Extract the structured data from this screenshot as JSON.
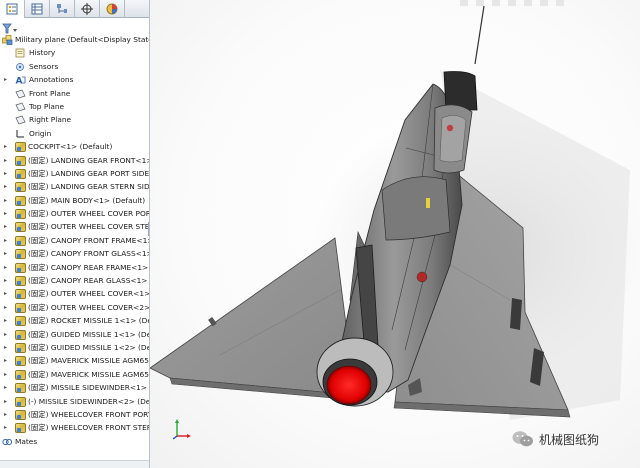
{
  "feature_tree": {
    "tabs": [
      {
        "icon": "feature-manager-icon"
      },
      {
        "icon": "property-manager-icon"
      },
      {
        "icon": "configuration-manager-icon"
      },
      {
        "icon": "dimxpert-manager-icon"
      },
      {
        "icon": "display-manager-icon"
      }
    ],
    "filter_icon": "filter-icon",
    "root": {
      "label": "Military plane  (Default<Display State-"
    },
    "folders": [
      {
        "label": "History",
        "icon": "history-icon",
        "expandable": false
      },
      {
        "label": "Sensors",
        "icon": "sensors-icon",
        "expandable": false
      },
      {
        "label": "Annotations",
        "icon": "annotations-icon",
        "expandable": true
      },
      {
        "label": "Front Plane",
        "icon": "plane-icon",
        "expandable": false
      },
      {
        "label": "Top Plane",
        "icon": "plane-icon",
        "expandable": false
      },
      {
        "label": "Right Plane",
        "icon": "plane-icon",
        "expandable": false
      },
      {
        "label": "Origin",
        "icon": "origin-icon",
        "expandable": false
      }
    ],
    "components": [
      "COCKPIT<1> (Default)",
      "(固定) LANDING GEAR FRONT<1>",
      "(固定) LANDING GEAR PORT SIDE",
      "(固定) LANDING GEAR STERN SIDE",
      "(固定) MAIN BODY<1> (Default)",
      "(固定) OUTER WHEEL COVER POR",
      "(固定) OUTER WHEEL COVER STER",
      "(固定) CANOPY FRONT FRAME<1>",
      "(固定) CANOPY FRONT GLASS<1>",
      "(固定) CANOPY REAR FRAME<1>",
      "(固定) CANOPY REAR GLASS<1> (",
      "(固定) OUTER WHEEL COVER<1>",
      "(固定) OUTER WHEEL COVER<2>",
      "(固定) ROCKET MISSILE 1<1> (De",
      "(固定) GUIDED MISSILE 1<1> (De",
      "(固定) GUIDED MISSILE 1<2> (De",
      "(固定) MAVERICK MISSILE AGM65",
      "(固定) MAVERICK MISSILE AGM65",
      "(固定) MISSILE SIDEWINDER<1> (",
      "(-) MISSILE SIDEWINDER<2> (De",
      "(固定) WHEELCOVER FRONT PORT",
      "(固定) WHEELCOVER FRONT STER"
    ],
    "mates": {
      "label": "Mates",
      "icon": "mates-icon"
    }
  },
  "viewport": {
    "model": "military-plane-model",
    "nozzle_color": "#e00000",
    "body_color": "#8c8c8c",
    "triad_icon": "coordinate-triad-icon"
  },
  "watermark": {
    "icon": "wechat-icon",
    "text": "机械图纸狗"
  },
  "colors": {
    "panel_bg": "#ffffff",
    "tab_gradient_top": "#f4f6f9",
    "tab_gradient_bottom": "#dde3ea"
  }
}
